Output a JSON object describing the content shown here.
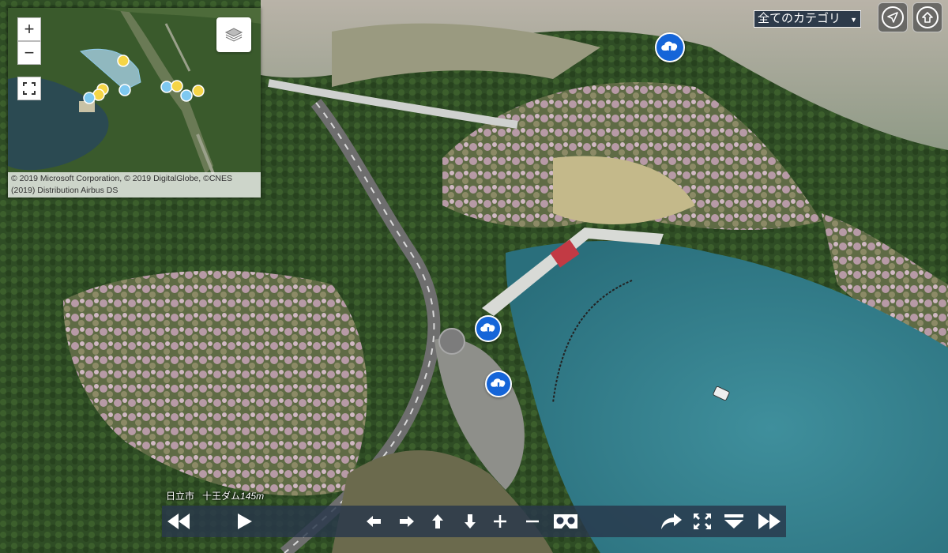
{
  "map": {
    "zoom_in_label": "+",
    "zoom_out_label": "−",
    "attribution": "© 2019 Microsoft Corporation, © 2019 DigitalGlobe, ©CNES (2019) Distribution Airbus DS"
  },
  "toolbar": {
    "category_label": "全てのカテゴリ",
    "category_arrow": "▼"
  },
  "location": {
    "city": "日立市",
    "place": "十王ダム",
    "altitude": "145m"
  },
  "icons": {
    "hotspot": "cloud-download-icon",
    "top_right": [
      "navigation-icon",
      "home-up-icon"
    ],
    "controls": [
      "rewind-icon",
      "play-icon",
      "pan-left-icon",
      "pan-right-icon",
      "pan-up-icon",
      "pan-down-icon",
      "zoom-in-icon",
      "zoom-out-icon",
      "vr-goggles-icon",
      "share-icon",
      "fullscreen-icon",
      "menu-down-icon",
      "fast-forward-icon"
    ]
  },
  "colors": {
    "hotspot": "#1565d8",
    "map_marker_yellow": "#f5d547",
    "map_marker_blue": "#7ec8f0",
    "controlbar": "#28374b"
  }
}
